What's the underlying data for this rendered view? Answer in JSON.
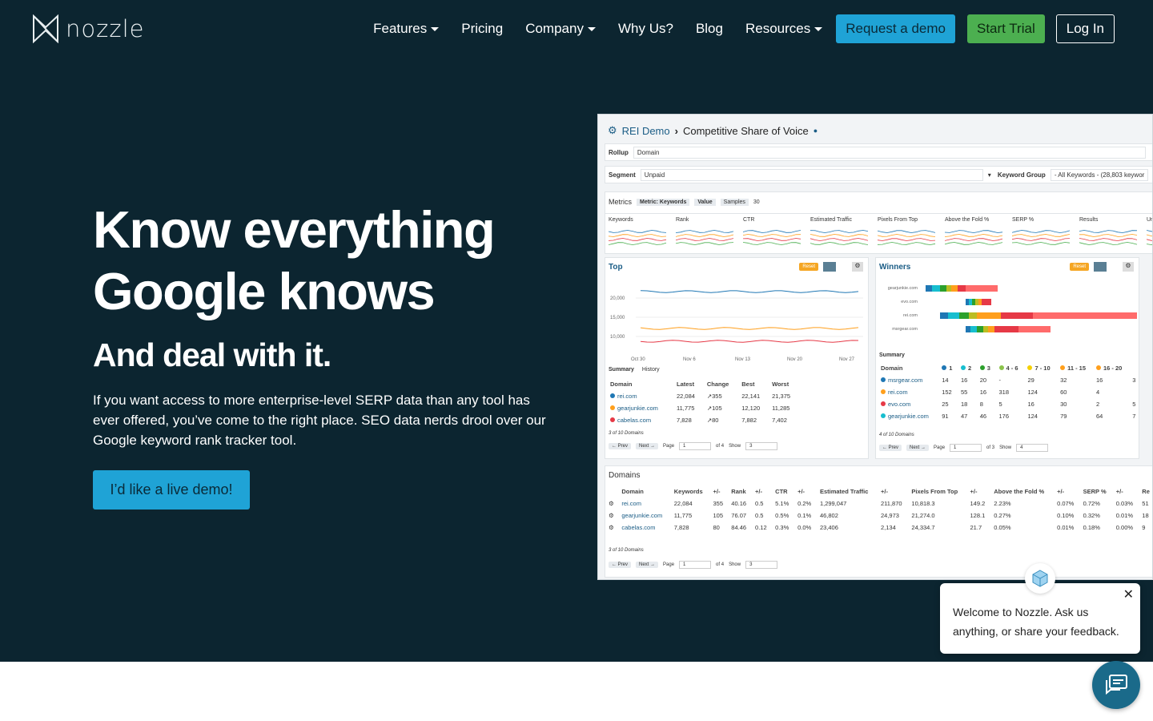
{
  "brand": {
    "name": "nozzle"
  },
  "nav": {
    "items": [
      {
        "label": "Features",
        "dropdown": true
      },
      {
        "label": "Pricing",
        "dropdown": false
      },
      {
        "label": "Company",
        "dropdown": true
      },
      {
        "label": "Why Us?",
        "dropdown": false
      },
      {
        "label": "Blog",
        "dropdown": false
      },
      {
        "label": "Resources",
        "dropdown": true
      }
    ],
    "request_demo": "Request a demo",
    "start_trial": "Start Trial",
    "log_in": "Log In"
  },
  "hero": {
    "headline_line1": "Know everything",
    "headline_line2": "Google knows",
    "subheadline": "And deal with it.",
    "paragraph": "If you want access to more enterprise-level SERP data than any tool has ever offered, you’ve come to the right place. SEO data nerds drool over our Google keyword rank tracker tool.",
    "cta": "I’d like a live demo!"
  },
  "screenshot": {
    "breadcrumb_root": "REI Demo",
    "breadcrumb_page": "Competitive Share of Voice",
    "rollup_label": "Rollup",
    "rollup_value": "Domain",
    "segment_label": "Segment",
    "segment_value": "Unpaid",
    "keyword_group_label": "Keyword Group",
    "keyword_group_value": "- All Keywords - (28,803 keywor",
    "metrics_label": "Metrics",
    "metric_chip": "Metric: Keywords",
    "value_chip": "Value",
    "samples_chip": "Samples",
    "samples_value": "30",
    "metric_tabs": [
      "Keywords",
      "Rank",
      "CTR",
      "Estimated Traffic",
      "Pixels From Top",
      "Above the Fold %",
      "SERP %",
      "Results",
      "Un"
    ],
    "top_title": "Top",
    "winners_title": "Winners",
    "reset": "Reset",
    "top_y_ticks": [
      "20,000",
      "15,000",
      "10,000"
    ],
    "top_x_ticks": [
      "Oct 30",
      "Nov 6",
      "Nov 13",
      "Nov 20",
      "Nov 27"
    ],
    "summary_tab": "Summary",
    "history_tab": "History",
    "top_headers": [
      "Domain",
      "Latest",
      "Change",
      "Best",
      "Worst"
    ],
    "top_rows": [
      {
        "domain": "rei.com",
        "latest": "22,084",
        "change": "355",
        "best": "22,141",
        "worst": "21,375",
        "color": "#1f77b4"
      },
      {
        "domain": "gearjunkie.com",
        "latest": "11,775",
        "change": "105",
        "best": "12,120",
        "worst": "11,285",
        "color": "#ff9f1c"
      },
      {
        "domain": "cabelas.com",
        "latest": "7,828",
        "change": "80",
        "best": "7,882",
        "worst": "7,402",
        "color": "#e63946"
      }
    ],
    "top_count": "3 of 10 Domains",
    "winners_domains": [
      "gearjunkie.com",
      "evo.com",
      "rei.com",
      "msrgear.com"
    ],
    "winners_summary_label": "Summary",
    "winners_headers": [
      "Domain",
      "1",
      "2",
      "3",
      "4 - 6",
      "7 - 10",
      "11 - 15",
      "16 - 20"
    ],
    "winners_rows": [
      {
        "domain": "msrgear.com",
        "vals": [
          "14",
          "16",
          "20",
          "-",
          "29",
          "32",
          "16",
          "3"
        ]
      },
      {
        "domain": "rei.com",
        "vals": [
          "152",
          "55",
          "16",
          "318",
          "124",
          "60",
          "4"
        ]
      },
      {
        "domain": "evo.com",
        "vals": [
          "25",
          "18",
          "8",
          "5",
          "16",
          "30",
          "2",
          "5"
        ]
      },
      {
        "domain": "gearjunkie.com",
        "vals": [
          "91",
          "47",
          "46",
          "176",
          "124",
          "79",
          "64",
          "7"
        ]
      }
    ],
    "winners_count": "4 of 10 Domains",
    "pager": {
      "prev": "Prev",
      "next": "Next",
      "page": "Page",
      "page_num": "1",
      "of4": "of 4",
      "of3": "of 3",
      "show": "Show",
      "show3": "3",
      "show4": "4"
    },
    "domains_title": "Domains",
    "domains_headers": [
      "Domain",
      "Keywords",
      "+/-",
      "Rank",
      "+/-",
      "CTR",
      "+/-",
      "Estimated Traffic",
      "+/-",
      "Pixels From Top",
      "+/-",
      "Above the Fold %",
      "+/-",
      "SERP %",
      "+/-",
      "Re"
    ],
    "domains_rows": [
      {
        "domain": "rei.com",
        "vals": [
          "22,084",
          "355",
          "40.16",
          "0.5",
          "5.1%",
          "0.2%",
          "1,299,047",
          "211,870",
          "10,818.3",
          "149.2",
          "2.23%",
          "0.07%",
          "0.72%",
          "0.03%",
          "51"
        ]
      },
      {
        "domain": "gearjunkie.com",
        "vals": [
          "11,775",
          "105",
          "76.07",
          "0.5",
          "0.5%",
          "0.1%",
          "46,802",
          "24,973",
          "21,274.0",
          "128.1",
          "0.27%",
          "0.10%",
          "0.32%",
          "0.01%",
          "18"
        ]
      },
      {
        "domain": "cabelas.com",
        "vals": [
          "7,828",
          "80",
          "84.46",
          "0.12",
          "0.3%",
          "0.0%",
          "23,406",
          "2,134",
          "24,334.7",
          "21.7",
          "0.05%",
          "0.01%",
          "0.18%",
          "0.00%",
          "9"
        ]
      }
    ],
    "domains_count": "3 of 10 Domains"
  },
  "chat": {
    "message": "Welcome to Nozzle. Ask us anything, or share your feedback."
  },
  "colors": {
    "hero_bg": "#0c2530",
    "primary_blue": "#1fa3d6",
    "trial_green": "#4caf50",
    "chat_button": "#1a6a8a"
  }
}
